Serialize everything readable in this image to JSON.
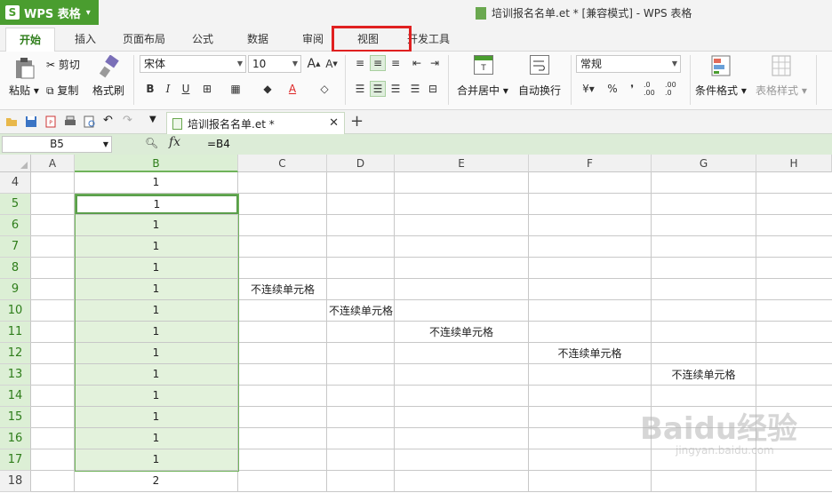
{
  "app": {
    "name": "WPS 表格",
    "logo": "S"
  },
  "window": {
    "title": "培训报名名单.et * [兼容模式] - WPS 表格"
  },
  "tabs": [
    {
      "label": "开始",
      "active": true
    },
    {
      "label": "插入"
    },
    {
      "label": "页面布局"
    },
    {
      "label": "公式"
    },
    {
      "label": "数据"
    },
    {
      "label": "审阅"
    },
    {
      "label": "视图"
    },
    {
      "label": "开发工具"
    }
  ],
  "ribbon": {
    "paste": "粘贴",
    "cut": "剪切",
    "copy": "复制",
    "format_painter": "格式刷",
    "font_name": "宋体",
    "font_size": "10",
    "bold": "B",
    "italic": "I",
    "underline": "U",
    "merge_center": "合并居中",
    "wrap_text": "自动换行",
    "number_format": "常规",
    "percent": "%",
    "comma": "❜",
    "inc_decimal": ".0 .00",
    "dec_decimal": ".00 .0",
    "cond_format": "条件格式",
    "table_style": "表格样式"
  },
  "doc_tab": {
    "name": "培训报名名单.et *"
  },
  "formula_bar": {
    "cell_ref": "B5",
    "fx": "fx",
    "content": "=B4"
  },
  "columns": [
    "A",
    "B",
    "C",
    "D",
    "E",
    "F",
    "G",
    "H"
  ],
  "rows": [
    {
      "num": "4",
      "b": "1"
    },
    {
      "num": "5",
      "b": "1"
    },
    {
      "num": "6",
      "b": "1"
    },
    {
      "num": "7",
      "b": "1"
    },
    {
      "num": "8",
      "b": "1"
    },
    {
      "num": "9",
      "b": "1",
      "c": "不连续单元格"
    },
    {
      "num": "10",
      "b": "1",
      "d": "不连续单元格"
    },
    {
      "num": "11",
      "b": "1",
      "e": "不连续单元格"
    },
    {
      "num": "12",
      "b": "1",
      "f": "不连续单元格"
    },
    {
      "num": "13",
      "b": "1",
      "g": "不连续单元格"
    },
    {
      "num": "14",
      "b": "1"
    },
    {
      "num": "15",
      "b": "1"
    },
    {
      "num": "16",
      "b": "1"
    },
    {
      "num": "17",
      "b": "1"
    },
    {
      "num": "18",
      "b": "2"
    }
  ],
  "watermark": {
    "text": "Baidu经验",
    "sub": "jingyan.baidu.com"
  },
  "colors": {
    "accent": "#4a9d2f",
    "selection": "#e3f2dc",
    "highlight": "#e02020"
  }
}
